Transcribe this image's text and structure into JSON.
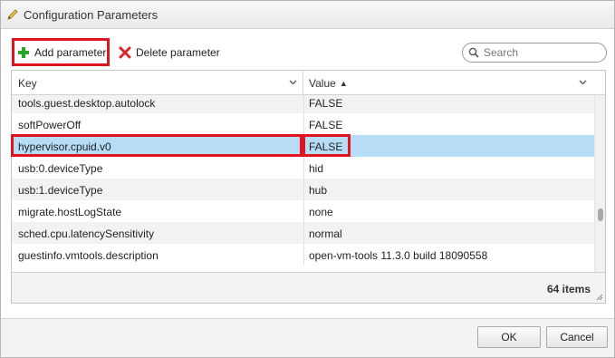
{
  "dialog": {
    "title": "Configuration Parameters",
    "title_icon": "pencil-icon"
  },
  "toolbar": {
    "add_label": "Add parameter",
    "add_icon": "plus-icon",
    "delete_label": "Delete parameter",
    "delete_icon": "x-icon"
  },
  "search": {
    "placeholder": "Search",
    "value": ""
  },
  "grid": {
    "columns": {
      "key": "Key",
      "value": "Value",
      "value_sort": "▲"
    },
    "rows": [
      {
        "key": "tools.guest.desktop.autolock",
        "value": "FALSE"
      },
      {
        "key": "softPowerOff",
        "value": "FALSE"
      },
      {
        "key": "hypervisor.cpuid.v0",
        "value": "FALSE",
        "selected": true
      },
      {
        "key": "usb:0.deviceType",
        "value": "hid"
      },
      {
        "key": "usb:1.deviceType",
        "value": "hub"
      },
      {
        "key": "migrate.hostLogState",
        "value": "none"
      },
      {
        "key": "sched.cpu.latencySensitivity",
        "value": "normal"
      },
      {
        "key": "guestinfo.vmtools.description",
        "value": "open-vm-tools 11.3.0 build 18090558"
      }
    ],
    "item_count": "64 items"
  },
  "buttons": {
    "ok": "OK",
    "cancel": "Cancel"
  },
  "colors": {
    "selection": "#b6dcf6",
    "highlight_box": "#e0141e",
    "add_icon": "#2aa52a",
    "delete_icon": "#d9262b"
  }
}
